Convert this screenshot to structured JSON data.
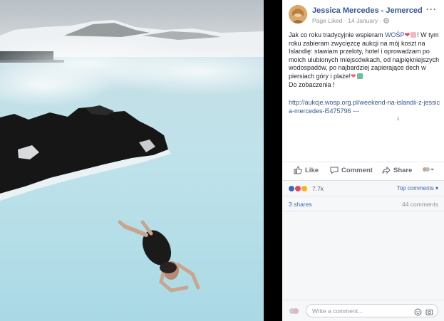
{
  "post": {
    "page_name": "Jessica Mercedes - Jemerced",
    "liked_status": "Page Liked",
    "date": "14 January",
    "text_before_tag": "Jak co roku tradycyjnie wspieram ",
    "tag": "WOŚP",
    "text_after_tag": "! W tym roku zabieram zwycięzcę aukcji na mój koszt na Islandię: stawiam przeloty, hotel i oprowadzam po moich ulubionych miejscówkach, od najpiękniejszych wodospadów, po najbardziej zapierające dech w piersiach góry i plaże!",
    "closing": "Do zobaczenia !",
    "link": "http://aukcje.wosp.org.pl/weekend-na-islandii-z-jessica-mercedes-i5475796",
    "link_suffix": " ---",
    "mini_mark": "1"
  },
  "actions": {
    "like": "Like",
    "comment": "Comment",
    "share": "Share"
  },
  "reactions": {
    "count": "7.7k",
    "top_comments": "Top comments ▾",
    "shares": "3 shares",
    "comments": "44 comments"
  },
  "composer": {
    "placeholder": "Write a comment..."
  },
  "colors": {
    "link_blue": "#365899",
    "heart_red": "#e8445a",
    "like_blue": "#4267b2",
    "water": "#cfe7ee"
  },
  "icons": [
    "more-options-icon",
    "globe-icon",
    "like-icon",
    "comment-icon",
    "share-icon",
    "audience-selector-icon",
    "emoji-icon",
    "camera-icon"
  ]
}
